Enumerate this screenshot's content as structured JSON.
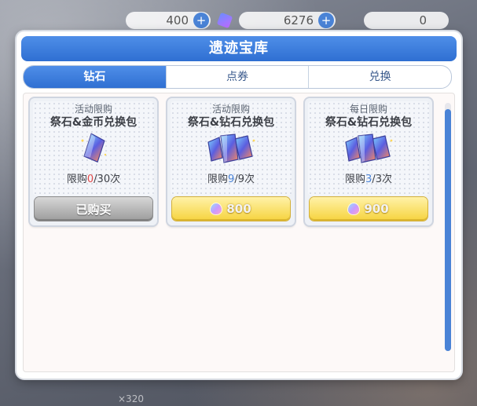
{
  "topbar": {
    "res1_value": "400",
    "res2_value": "6276",
    "res3_value": "0",
    "plus_glyph": "+"
  },
  "background": {
    "bottom_count": "×320",
    "bottom_hint": ""
  },
  "modal": {
    "title": "遗迹宝库",
    "tabs": [
      {
        "label": "钻石",
        "active": true
      },
      {
        "label": "点券",
        "active": false
      },
      {
        "label": "兑换",
        "active": false
      }
    ],
    "cards": [
      {
        "tag": "活动限购",
        "name": "祭石&金币兑换包",
        "limit_prefix": "限购",
        "limit_used": "0",
        "limit_total": "/30次",
        "button_label": "已购买",
        "button_state": "purchased",
        "icon": "crystal-single-icon"
      },
      {
        "tag": "活动限购",
        "name": "祭石&钻石兑换包",
        "limit_prefix": "限购",
        "limit_used": "9",
        "limit_total": "/9次",
        "button_label": "800",
        "button_state": "price",
        "icon": "crystal-triple-icon"
      },
      {
        "tag": "每日限购",
        "name": "祭石&钻石兑换包",
        "limit_prefix": "限购",
        "limit_used": "3",
        "limit_total": "/3次",
        "button_label": "900",
        "button_state": "price",
        "icon": "crystal-triple-icon"
      }
    ]
  },
  "colors": {
    "accent_blue": "#2f6fd2",
    "button_gold": "#f6d33e",
    "limit_red": "#e24b4b"
  }
}
